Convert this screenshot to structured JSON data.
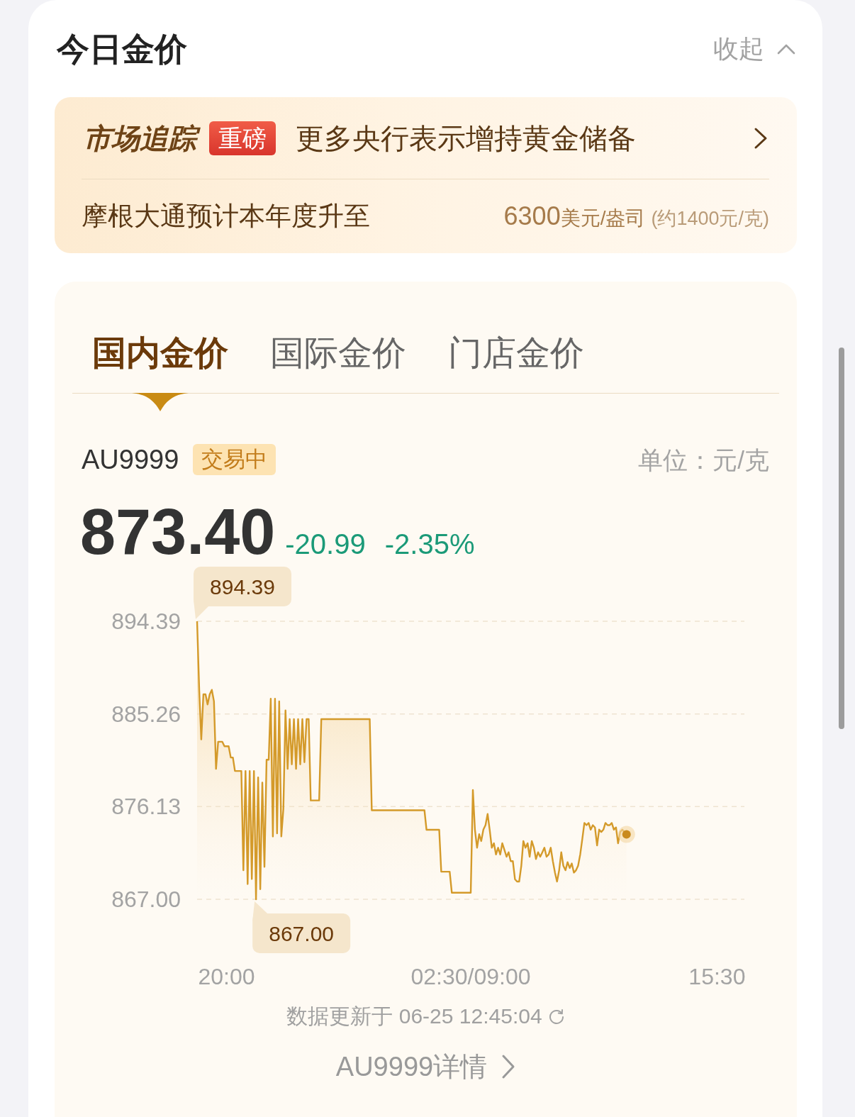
{
  "header": {
    "title": "今日金价",
    "collapse_label": "收起"
  },
  "news": {
    "brand": "市场追踪",
    "badge": "重磅",
    "headline": "更多央行表示增持黄金储备",
    "forecast": {
      "text": "摩根大通预计本年度升至",
      "value": "6300",
      "unit": "美元/盎司",
      "note": "(约1400元/克)"
    }
  },
  "price_card": {
    "tabs": [
      {
        "label": "国内金价",
        "selected": true
      },
      {
        "label": "国际金价",
        "selected": false
      },
      {
        "label": "门店金价",
        "selected": false
      }
    ],
    "symbol": "AU9999",
    "status": "交易中",
    "unit": "单位：元/克",
    "price": "873.40",
    "change": "-20.99",
    "change_percent": "-2.35%",
    "chart": {
      "chart_data": {
        "type": "area",
        "ylim": [
          867,
          894.39
        ],
        "yticks": [
          {
            "value": 894.39,
            "label": "894.39"
          },
          {
            "value": 885.26,
            "label": "885.26"
          },
          {
            "value": 876.13,
            "label": "876.13"
          },
          {
            "value": 867,
            "label": "867.00"
          }
        ],
        "categories": [
          null,
          null,
          null,
          null,
          null,
          null,
          null,
          null,
          null,
          null,
          null,
          null,
          null,
          null,
          "20:00",
          null,
          null,
          null,
          null,
          null,
          null,
          null,
          null,
          null,
          null,
          null,
          null,
          null,
          null,
          null,
          null,
          null,
          null,
          null,
          null,
          null,
          null,
          null,
          null,
          null,
          null,
          null,
          null,
          null,
          null,
          null,
          null,
          null,
          null,
          null,
          null,
          null,
          null,
          null,
          null,
          null,
          null,
          null,
          null,
          null,
          null,
          null,
          null,
          null,
          null,
          null,
          null,
          null,
          null,
          null,
          null,
          null,
          null,
          null,
          null,
          null,
          null,
          null,
          null,
          null,
          null,
          null,
          null,
          null,
          null,
          null,
          null,
          null,
          null,
          null,
          null,
          null,
          null,
          null,
          null,
          null,
          null,
          null,
          null,
          null,
          null,
          null,
          null,
          null,
          null,
          null,
          null,
          null,
          null,
          null,
          null,
          null,
          null,
          null,
          null,
          null,
          null,
          null,
          null,
          null,
          null,
          null,
          null,
          null,
          null,
          null,
          null,
          null,
          null,
          null,
          "02:30/09:00",
          null,
          null,
          null,
          null,
          null,
          null,
          null,
          null,
          null,
          null,
          null,
          null,
          null,
          null,
          null,
          null,
          null,
          null,
          null,
          null,
          null,
          null,
          null,
          null,
          null,
          null,
          null,
          null,
          null,
          null,
          null,
          null,
          null,
          null,
          null,
          null,
          null,
          null,
          null,
          null,
          null,
          null,
          null,
          null,
          null,
          null,
          null,
          null,
          null,
          null,
          null,
          null,
          null,
          null,
          null,
          null,
          null,
          null,
          null,
          null,
          null,
          null,
          null,
          null,
          null,
          null,
          null,
          null,
          null,
          null,
          null,
          null,
          null,
          null,
          null,
          null,
          null,
          null,
          null,
          null,
          null,
          null,
          null,
          null,
          null,
          null,
          null,
          null,
          null,
          null,
          null,
          null,
          null,
          null,
          null,
          null,
          null,
          null,
          null,
          null,
          null,
          null,
          null,
          null,
          null,
          null,
          null,
          null,
          null,
          null,
          null,
          null,
          null,
          null,
          null,
          null,
          "15:30",
          null,
          null,
          null,
          null,
          null,
          null,
          null,
          null,
          null,
          null,
          null,
          null,
          null
        ],
        "values": [
          894.39,
          887.63,
          882.75,
          887.19,
          887.19,
          886.2,
          887.19,
          887.63,
          886.5,
          879.85,
          882.52,
          882.52,
          882.52,
          882.08,
          882.08,
          882.08,
          880.97,
          880.97,
          879.64,
          879.64,
          879.64,
          879.64,
          869.86,
          879.64,
          868.5,
          879.64,
          869.0,
          879.64,
          867.0,
          879.0,
          868.0,
          878.5,
          870.2,
          880.75,
          880.75,
          886.75,
          873.19,
          886.75,
          873.5,
          886.5,
          873.19,
          875.9,
          885.6,
          879.85,
          884.75,
          880.3,
          884.75,
          879.85,
          884.75,
          880.3,
          884.75,
          880.5,
          884.75,
          884.75,
          876.74,
          876.74,
          876.74,
          876.74,
          876.74,
          884.75,
          884.75,
          884.75,
          884.75,
          884.75,
          884.75,
          884.75,
          884.75,
          884.75,
          884.75,
          884.75,
          884.75,
          884.75,
          884.75,
          884.75,
          884.75,
          884.75,
          884.75,
          884.75,
          884.75,
          884.75,
          884.75,
          884.75,
          884.75,
          875.77,
          875.77,
          875.77,
          875.77,
          875.77,
          875.77,
          875.77,
          875.77,
          875.77,
          875.77,
          875.77,
          875.77,
          875.77,
          875.77,
          875.77,
          875.77,
          875.77,
          875.77,
          875.77,
          875.77,
          875.77,
          875.77,
          875.77,
          875.77,
          875.77,
          875.77,
          873.85,
          873.85,
          873.85,
          873.85,
          873.85,
          873.85,
          873.85,
          869.72,
          869.72,
          869.72,
          869.72,
          869.72,
          867.64,
          867.64,
          867.64,
          867.64,
          867.64,
          867.64,
          867.64,
          867.64,
          867.64,
          867.64,
          877.77,
          873.86,
          872.08,
          873.41,
          872.74,
          873.86,
          874.3,
          875.41,
          873.86,
          872.08,
          872.52,
          871.41,
          872.08,
          871.41,
          872.52,
          871.86,
          871.19,
          871.63,
          870.75,
          870.75,
          868.97,
          868.75,
          868.75,
          870.3,
          872.74,
          872.08,
          872.52,
          871.19,
          872.74,
          872.08,
          870.97,
          871.63,
          871.19,
          871.63,
          872.08,
          871.19,
          871.41,
          872.08,
          870.75,
          869.63,
          868.75,
          869.86,
          871.63,
          870.3,
          869.86,
          870.66,
          870.08,
          870.52,
          869.63,
          869.86,
          870.3,
          871.41,
          872.97,
          874.52,
          874.3,
          874.52,
          873.86,
          874.3,
          874.08,
          872.3,
          873.86,
          873.63,
          873.86,
          874.52,
          874.3,
          874.3,
          874.52,
          873.86,
          874.08,
          872.52,
          873.63,
          873.86,
          873.63,
          873.4,
          null,
          null,
          null,
          null,
          null,
          null,
          null,
          null,
          null,
          null,
          null,
          null,
          null,
          null,
          null,
          null,
          null,
          null,
          null,
          null,
          null,
          null,
          null,
          null,
          null,
          null,
          null,
          null,
          null,
          null,
          null,
          null,
          null,
          null,
          null,
          null,
          null,
          null,
          null,
          null,
          null,
          null,
          null,
          null,
          null,
          null,
          null,
          null,
          null,
          null,
          null,
          null,
          null,
          null,
          null,
          null
        ],
        "annotations": [
          "894.39",
          "867.00"
        ]
      }
    },
    "updated": "数据更新于 06-25 12:45:04",
    "details_link": "AU9999详情"
  }
}
